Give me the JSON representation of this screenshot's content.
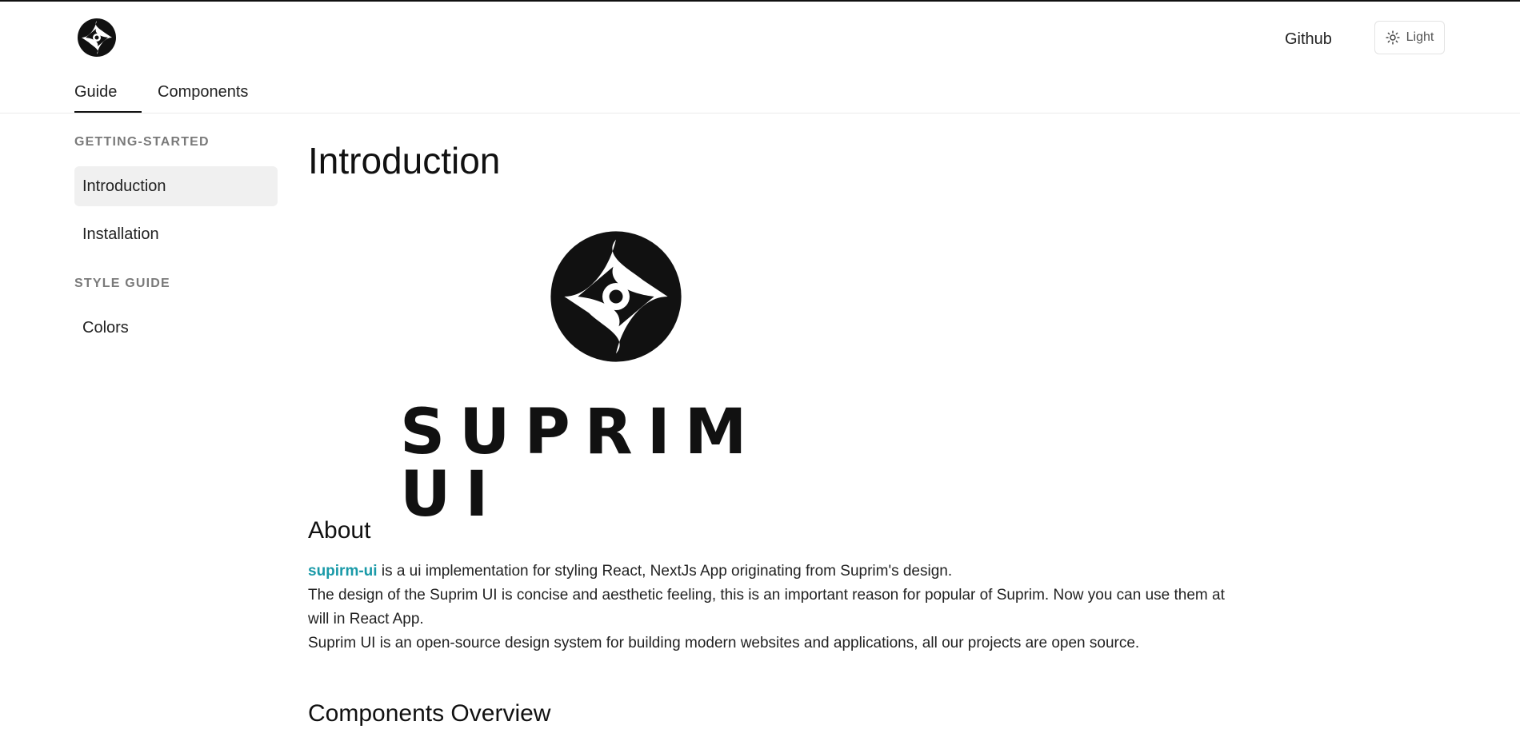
{
  "header": {
    "github_label": "Github",
    "theme_label": "Light",
    "tabs": [
      {
        "label": "Guide",
        "active": true
      },
      {
        "label": "Components",
        "active": false
      }
    ]
  },
  "sidebar": {
    "sections": [
      {
        "title": "GETTING-STARTED",
        "items": [
          {
            "label": "Introduction",
            "active": true
          },
          {
            "label": "Installation",
            "active": false
          }
        ]
      },
      {
        "title": "STYLE GUIDE",
        "items": [
          {
            "label": "Colors",
            "active": false
          }
        ]
      }
    ]
  },
  "main": {
    "title": "Introduction",
    "brand_wordmark": "SUPRIM UI",
    "about": {
      "heading": "About",
      "link_text": "supirm-ui",
      "line1_rest": " is a ui implementation for styling React, NextJs App originating from Suprim's design.",
      "line2": "The design of the Suprim UI is concise and aesthetic feeling, this is an important reason for popular of Suprim. Now you can use them at will in React App.",
      "line3": "Suprim UI is an open-source design system for building modern websites and applications, all our projects are open source."
    },
    "overview": {
      "heading": "Components Overview"
    }
  },
  "colors": {
    "accent_link": "#1a9aa8",
    "active_bg": "#f0f0f0",
    "muted_section": "#7a7a7a"
  },
  "icons": {
    "logo": "suprim-logo-icon",
    "theme": "sun-icon"
  }
}
